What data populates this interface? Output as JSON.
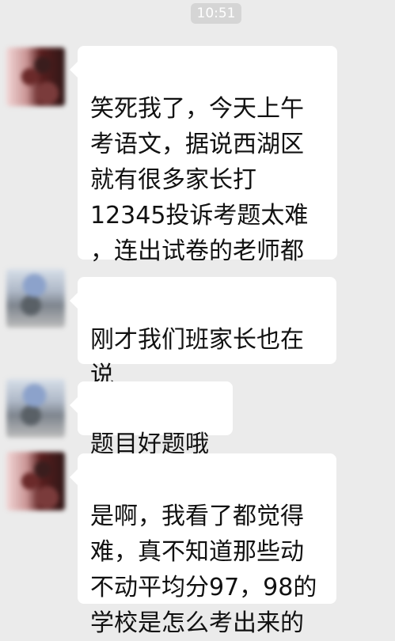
{
  "time": "10:51",
  "messages": [
    {
      "text": "笑死我了，今天上午\n考语文，据说西湖区\n就有很多家长打\n12345投诉考题太难\n，连出试卷的老师都\n被挖出来了",
      "emoji": "grinning-face-emoji"
    },
    {
      "text": "刚才我们班家长也在\n说"
    },
    {
      "text": "题目好题哦"
    },
    {
      "text": "是啊，我看了都觉得\n难，真不知道那些动\n不动平均分97，98的\n学校是怎么考出来的"
    }
  ]
}
